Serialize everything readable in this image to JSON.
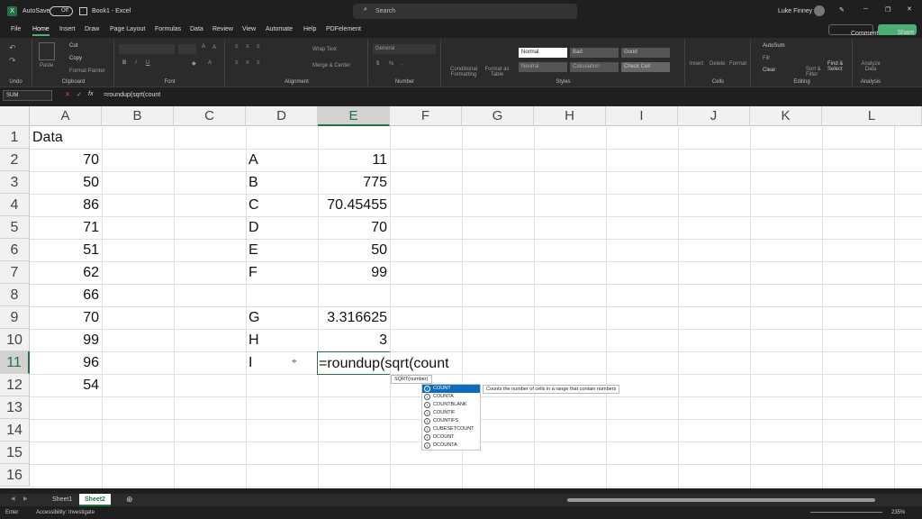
{
  "titlebar": {
    "autosave": "AutoSave",
    "toggle": "Off",
    "book": "Book1 - Excel",
    "search": "Search",
    "user": "Luke Finney"
  },
  "ribbon_tabs": [
    "File",
    "Home",
    "Insert",
    "Draw",
    "Page Layout",
    "Formulas",
    "Data",
    "Review",
    "View",
    "Automate",
    "Help",
    "PDFelement"
  ],
  "ribbon_right": {
    "comments": "Comments",
    "share": "Share"
  },
  "groups": {
    "undo": "Undo",
    "clipboard": "Clipboard",
    "font": "Font",
    "alignment": "Alignment",
    "number": "Number",
    "styles": "Styles",
    "cells": "Cells",
    "editing": "Editing",
    "analysis": "Analysis"
  },
  "clip": {
    "paste": "Paste",
    "cut": "Cut",
    "copy": "Copy",
    "painter": "Format Painter"
  },
  "align": {
    "wrap": "Wrap Text",
    "merge": "Merge & Center"
  },
  "number": {
    "format": "General"
  },
  "styles": {
    "normal": "Normal",
    "bad": "Bad",
    "good": "Good",
    "neutral": "Neutral",
    "calc": "Calculation",
    "check": "Check Cell",
    "cond": "Conditional Formatting",
    "fmt": "Format as Table",
    "cellstyles": "Cell Styles"
  },
  "cells": {
    "insert": "Insert",
    "delete": "Delete",
    "format": "Format"
  },
  "editing": {
    "autosum": "AutoSum",
    "fill": "Fill",
    "clear": "Clear",
    "sort": "Sort & Filter",
    "find": "Find & Select"
  },
  "analysis": {
    "analyze": "Analyze Data"
  },
  "formulabar": {
    "namebox": "SUM",
    "fx": "fx",
    "formula": "=roundup(sqrt(count"
  },
  "columns": [
    "A",
    "B",
    "C",
    "D",
    "E",
    "F",
    "G",
    "H",
    "I",
    "J",
    "K",
    "L"
  ],
  "rows": [
    "1",
    "2",
    "3",
    "4",
    "5",
    "6",
    "7",
    "8",
    "9",
    "10",
    "11",
    "12",
    "13",
    "14",
    "15",
    "16"
  ],
  "colA": [
    "Data",
    "70",
    "50",
    "86",
    "71",
    "51",
    "62",
    "66",
    "70",
    "99",
    "96",
    "54"
  ],
  "colD": [
    "",
    "A",
    "B",
    "C",
    "D",
    "E",
    "F",
    "",
    "G",
    "H",
    "I"
  ],
  "colE": [
    "",
    "11",
    "775",
    "70.45455",
    "70",
    "50",
    "99",
    "",
    "3.316625",
    "3",
    ""
  ],
  "editing_cell": "=roundup(sqrt(count",
  "tooltip": "SQRT(number)",
  "autocomplete": [
    "COUNT",
    "COUNTA",
    "COUNTBLANK",
    "COUNTIF",
    "COUNTIFS",
    "CUBESETCOUNT",
    "DCOUNT",
    "DCOUNTA"
  ],
  "ac_desc": "Counts the number of cells in a range that contain numbers",
  "sheets": [
    "Sheet1",
    "Sheet2"
  ],
  "status": {
    "mode": "Enter",
    "access": "Accessibility: Investigate",
    "zoom": "235%"
  },
  "colors": {
    "accent": "#217346",
    "selected": "#c6efce"
  }
}
